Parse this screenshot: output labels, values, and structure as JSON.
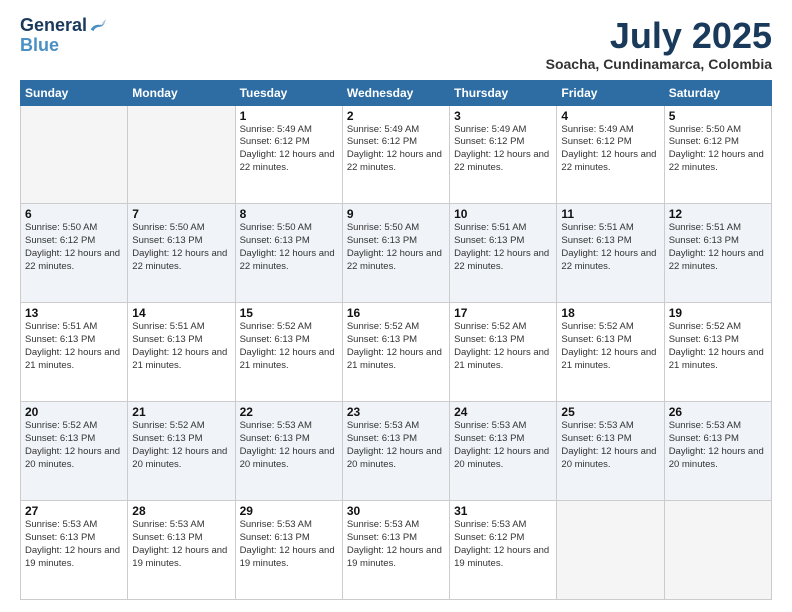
{
  "header": {
    "logo_line1": "General",
    "logo_line2": "Blue",
    "month": "July 2025",
    "location": "Soacha, Cundinamarca, Colombia"
  },
  "weekdays": [
    "Sunday",
    "Monday",
    "Tuesday",
    "Wednesday",
    "Thursday",
    "Friday",
    "Saturday"
  ],
  "weeks": [
    [
      {
        "day": "",
        "empty": true
      },
      {
        "day": "",
        "empty": true
      },
      {
        "day": "1",
        "sunrise": "5:49 AM",
        "sunset": "6:12 PM",
        "daylight": "12 hours and 22 minutes."
      },
      {
        "day": "2",
        "sunrise": "5:49 AM",
        "sunset": "6:12 PM",
        "daylight": "12 hours and 22 minutes."
      },
      {
        "day": "3",
        "sunrise": "5:49 AM",
        "sunset": "6:12 PM",
        "daylight": "12 hours and 22 minutes."
      },
      {
        "day": "4",
        "sunrise": "5:49 AM",
        "sunset": "6:12 PM",
        "daylight": "12 hours and 22 minutes."
      },
      {
        "day": "5",
        "sunrise": "5:50 AM",
        "sunset": "6:12 PM",
        "daylight": "12 hours and 22 minutes."
      }
    ],
    [
      {
        "day": "6",
        "sunrise": "5:50 AM",
        "sunset": "6:12 PM",
        "daylight": "12 hours and 22 minutes."
      },
      {
        "day": "7",
        "sunrise": "5:50 AM",
        "sunset": "6:13 PM",
        "daylight": "12 hours and 22 minutes."
      },
      {
        "day": "8",
        "sunrise": "5:50 AM",
        "sunset": "6:13 PM",
        "daylight": "12 hours and 22 minutes."
      },
      {
        "day": "9",
        "sunrise": "5:50 AM",
        "sunset": "6:13 PM",
        "daylight": "12 hours and 22 minutes."
      },
      {
        "day": "10",
        "sunrise": "5:51 AM",
        "sunset": "6:13 PM",
        "daylight": "12 hours and 22 minutes."
      },
      {
        "day": "11",
        "sunrise": "5:51 AM",
        "sunset": "6:13 PM",
        "daylight": "12 hours and 22 minutes."
      },
      {
        "day": "12",
        "sunrise": "5:51 AM",
        "sunset": "6:13 PM",
        "daylight": "12 hours and 22 minutes."
      }
    ],
    [
      {
        "day": "13",
        "sunrise": "5:51 AM",
        "sunset": "6:13 PM",
        "daylight": "12 hours and 21 minutes."
      },
      {
        "day": "14",
        "sunrise": "5:51 AM",
        "sunset": "6:13 PM",
        "daylight": "12 hours and 21 minutes."
      },
      {
        "day": "15",
        "sunrise": "5:52 AM",
        "sunset": "6:13 PM",
        "daylight": "12 hours and 21 minutes."
      },
      {
        "day": "16",
        "sunrise": "5:52 AM",
        "sunset": "6:13 PM",
        "daylight": "12 hours and 21 minutes."
      },
      {
        "day": "17",
        "sunrise": "5:52 AM",
        "sunset": "6:13 PM",
        "daylight": "12 hours and 21 minutes."
      },
      {
        "day": "18",
        "sunrise": "5:52 AM",
        "sunset": "6:13 PM",
        "daylight": "12 hours and 21 minutes."
      },
      {
        "day": "19",
        "sunrise": "5:52 AM",
        "sunset": "6:13 PM",
        "daylight": "12 hours and 21 minutes."
      }
    ],
    [
      {
        "day": "20",
        "sunrise": "5:52 AM",
        "sunset": "6:13 PM",
        "daylight": "12 hours and 20 minutes."
      },
      {
        "day": "21",
        "sunrise": "5:52 AM",
        "sunset": "6:13 PM",
        "daylight": "12 hours and 20 minutes."
      },
      {
        "day": "22",
        "sunrise": "5:53 AM",
        "sunset": "6:13 PM",
        "daylight": "12 hours and 20 minutes."
      },
      {
        "day": "23",
        "sunrise": "5:53 AM",
        "sunset": "6:13 PM",
        "daylight": "12 hours and 20 minutes."
      },
      {
        "day": "24",
        "sunrise": "5:53 AM",
        "sunset": "6:13 PM",
        "daylight": "12 hours and 20 minutes."
      },
      {
        "day": "25",
        "sunrise": "5:53 AM",
        "sunset": "6:13 PM",
        "daylight": "12 hours and 20 minutes."
      },
      {
        "day": "26",
        "sunrise": "5:53 AM",
        "sunset": "6:13 PM",
        "daylight": "12 hours and 20 minutes."
      }
    ],
    [
      {
        "day": "27",
        "sunrise": "5:53 AM",
        "sunset": "6:13 PM",
        "daylight": "12 hours and 19 minutes."
      },
      {
        "day": "28",
        "sunrise": "5:53 AM",
        "sunset": "6:13 PM",
        "daylight": "12 hours and 19 minutes."
      },
      {
        "day": "29",
        "sunrise": "5:53 AM",
        "sunset": "6:13 PM",
        "daylight": "12 hours and 19 minutes."
      },
      {
        "day": "30",
        "sunrise": "5:53 AM",
        "sunset": "6:13 PM",
        "daylight": "12 hours and 19 minutes."
      },
      {
        "day": "31",
        "sunrise": "5:53 AM",
        "sunset": "6:12 PM",
        "daylight": "12 hours and 19 minutes."
      },
      {
        "day": "",
        "empty": true
      },
      {
        "day": "",
        "empty": true
      }
    ]
  ]
}
